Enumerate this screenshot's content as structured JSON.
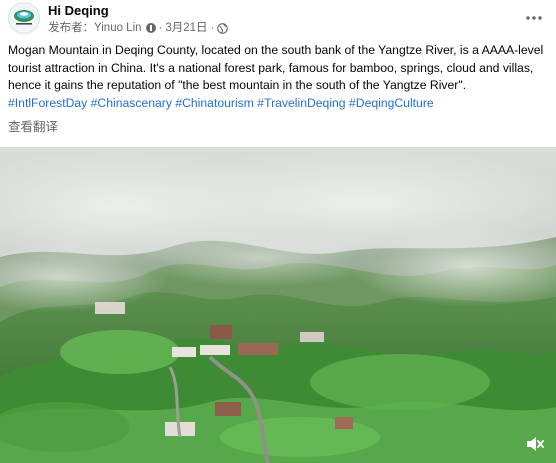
{
  "post": {
    "page_name": "Hi Deqing",
    "meta": {
      "publisher_label": "发布者：",
      "author": "Yinuo Lin",
      "date": "3月21日",
      "separator": "·",
      "audience_icon": "globe-icon",
      "info_icon": "question-icon"
    },
    "caption_text": "Mogan Mountain in Deqing County, located on the south bank of the Yangtze River, is a AAAA-level tourist attraction in China. It's a national forest park, famous for bamboo, springs, cloud and villas, hence it gains the reputation of \"the best mountain in the south of the Yangtze River\".",
    "hashtags": [
      "#IntlForestDay",
      "#Chinascenary",
      "#Chinatourism",
      "#TravelinDeqing",
      "#DeqingCulture"
    ],
    "see_translation": "查看翻译",
    "more_icon": "more-horizontal-icon",
    "video": {
      "mute_icon": "volume-muted-icon"
    },
    "colors": {
      "hashtag": "#216fdb",
      "text": "#050505",
      "secondary": "#65676b"
    }
  }
}
